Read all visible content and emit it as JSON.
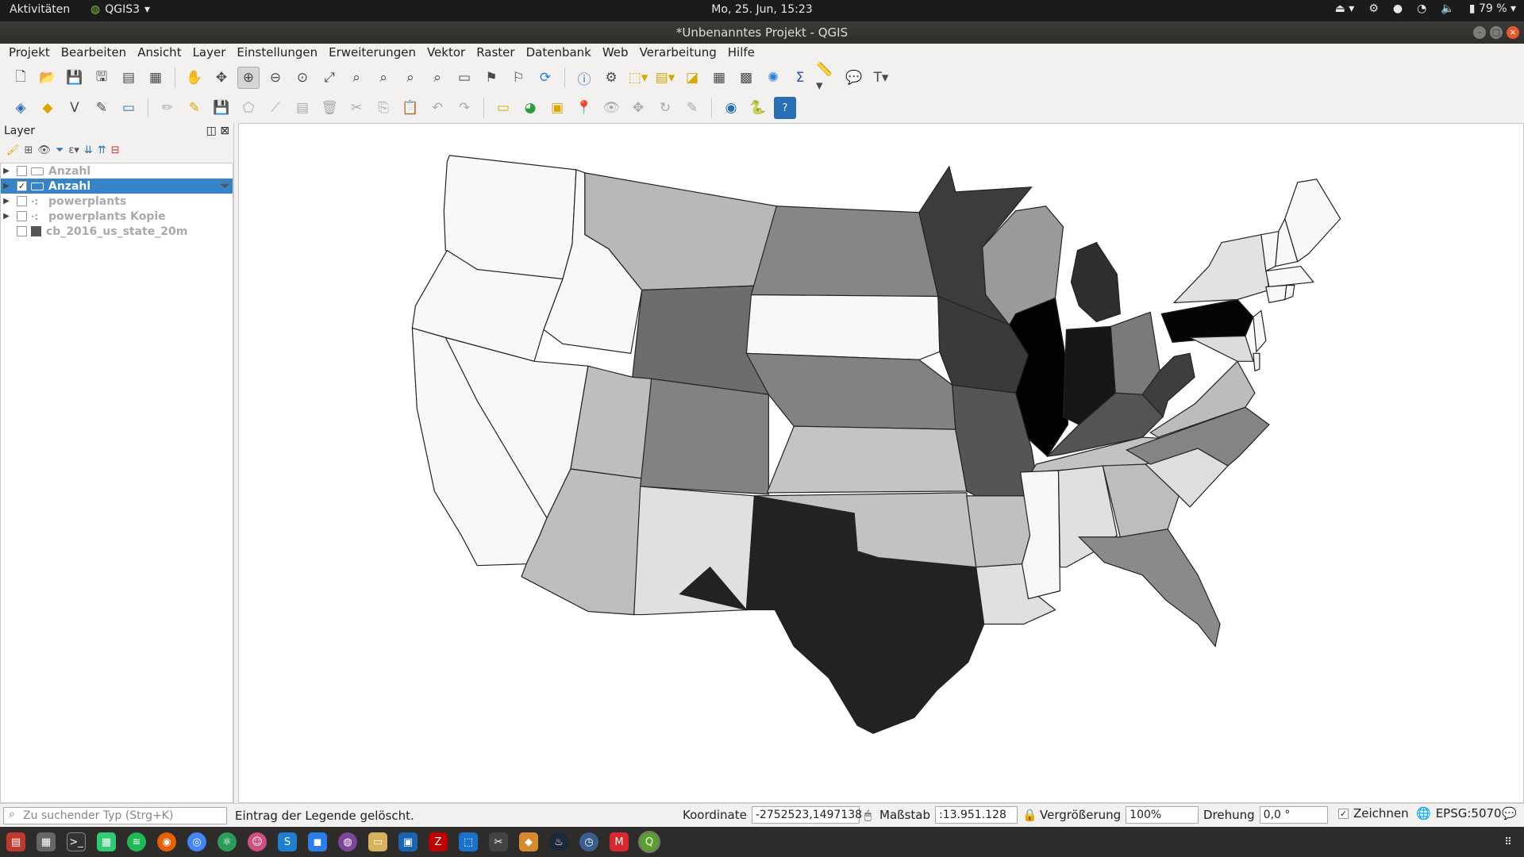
{
  "system_bar": {
    "activities": "Aktivitäten",
    "app_name": "QGIS3",
    "clock": "Mo, 25. Jun, 15:23",
    "battery": "79 %"
  },
  "window": {
    "title": "*Unbenanntes Projekt - QGIS"
  },
  "menu": [
    "Projekt",
    "Bearbeiten",
    "Ansicht",
    "Layer",
    "Einstellungen",
    "Erweiterungen",
    "Vektor",
    "Raster",
    "Datenbank",
    "Web",
    "Verarbeitung",
    "Hilfe"
  ],
  "layer_panel": {
    "title": "Layer",
    "layers": [
      {
        "name": "Anzahl",
        "checked": false,
        "selected": false
      },
      {
        "name": "Anzahl",
        "checked": true,
        "selected": true
      },
      {
        "name": "powerplants",
        "checked": false,
        "selected": false
      },
      {
        "name": "powerplants Kopie",
        "checked": false,
        "selected": false
      },
      {
        "name": "cb_2016_us_state_20m",
        "checked": false,
        "selected": false
      }
    ]
  },
  "statusbar": {
    "search_placeholder": "Zu suchender Typ (Strg+K)",
    "message": "Eintrag der Legende gelöscht.",
    "coord_label": "Koordinate",
    "coord_value": "-2752523,1497138",
    "scale_label": "Maßstab",
    "scale_value": ":13.951.128",
    "zoom_label": "Vergrößerung",
    "zoom_value": "100%",
    "rotation_label": "Drehung",
    "rotation_value": "0,0 °",
    "render_label": "Zeichnen",
    "crs": "EPSG:5070"
  },
  "colors": {
    "selection": "#3584c8",
    "accent": "#e9592b"
  }
}
